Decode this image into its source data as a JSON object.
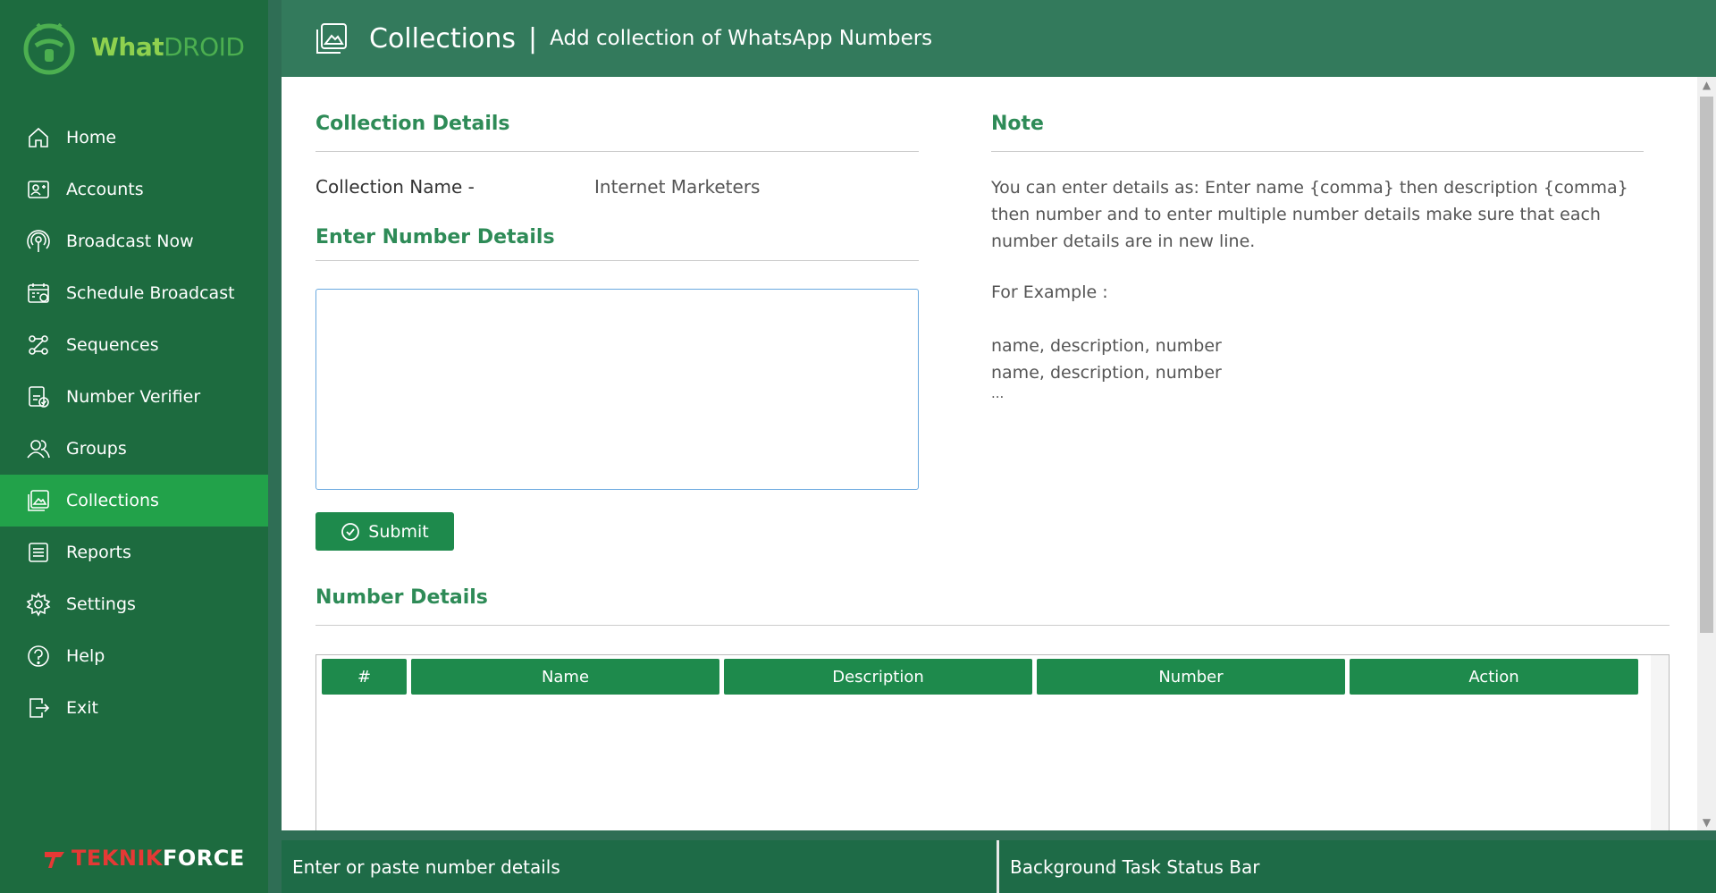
{
  "app": {
    "name_part1": "What",
    "name_part2": "DROID"
  },
  "sidebar": {
    "items": [
      {
        "label": "Home",
        "icon": "home-icon"
      },
      {
        "label": "Accounts",
        "icon": "accounts-icon"
      },
      {
        "label": "Broadcast Now",
        "icon": "broadcast-icon"
      },
      {
        "label": "Schedule Broadcast",
        "icon": "calendar-icon"
      },
      {
        "label": "Sequences",
        "icon": "sequences-icon"
      },
      {
        "label": "Number Verifier",
        "icon": "number-verifier-icon"
      },
      {
        "label": "Groups",
        "icon": "groups-icon"
      },
      {
        "label": "Collections",
        "icon": "collections-icon",
        "active": true
      },
      {
        "label": "Reports",
        "icon": "reports-icon"
      },
      {
        "label": "Settings",
        "icon": "gear-icon"
      },
      {
        "label": "Help",
        "icon": "help-icon"
      },
      {
        "label": "Exit",
        "icon": "exit-icon"
      }
    ],
    "brand_part1": "TEKNIK",
    "brand_part2": "FORCE"
  },
  "header": {
    "title": "Collections",
    "separator": "|",
    "subtitle": "Add collection of WhatsApp Numbers"
  },
  "collection_details": {
    "section_title": "Collection Details",
    "name_label": "Collection Name -",
    "name_value": "Internet Marketers"
  },
  "enter_numbers": {
    "section_title": "Enter Number Details",
    "value": "",
    "placeholder": "",
    "submit_label": "Submit"
  },
  "note": {
    "section_title": "Note",
    "text": "You can enter details as: Enter name {comma} then description {comma} then number and to enter multiple number details make sure that each number details are in new line.",
    "example_label": "For Example :",
    "example_line1": "name, description, number",
    "example_line2": "name, description, number",
    "example_line3": "..."
  },
  "number_details": {
    "section_title": "Number Details",
    "columns": [
      "#",
      "Name",
      "Description",
      "Number",
      "Action"
    ],
    "rows": []
  },
  "statusbar": {
    "left": "Enter or paste number details",
    "right": "Background Task Status Bar"
  },
  "colors": {
    "sidebar": "#1d6b3f",
    "active": "#22a24a",
    "accent": "#2e8b57",
    "button": "#1e8a4c",
    "brand_red": "#e53935"
  }
}
